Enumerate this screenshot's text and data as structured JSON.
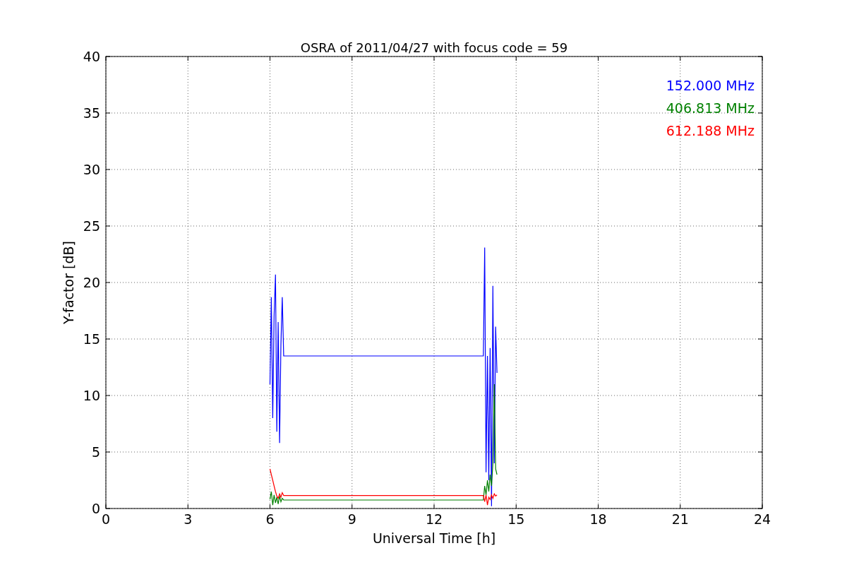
{
  "chart_data": {
    "type": "line",
    "title": "OSRA of 2011/04/27 with focus code = 59",
    "xlabel": "Universal Time [h]",
    "ylabel": "Y-factor [dB]",
    "x": [
      6.0,
      6.05,
      6.1,
      6.15,
      6.2,
      6.25,
      6.3,
      6.35,
      6.4,
      6.45,
      6.5,
      13.8,
      13.85,
      13.9,
      13.95,
      14.0,
      14.05,
      14.1,
      14.15,
      14.2,
      14.25,
      14.3
    ],
    "series": [
      {
        "name": "152.000 MHz",
        "color": "#0000ff",
        "values": [
          11,
          18.7,
          8,
          17,
          20.7,
          6.8,
          16.5,
          5.8,
          14.5,
          18.7,
          13.5,
          13.5,
          23.1,
          3.2,
          13.5,
          2.5,
          14.2,
          0.2,
          19.7,
          4,
          16.1,
          12
        ]
      },
      {
        "name": "406.813 MHz",
        "color": "#008000",
        "values": [
          0.8,
          1.5,
          0.3,
          1.2,
          0.5,
          1.0,
          0.4,
          1.1,
          0.6,
          0.9,
          0.75,
          0.75,
          2,
          1.2,
          2.5,
          1.5,
          3,
          2,
          4,
          11,
          3.5,
          3
        ]
      },
      {
        "name": "612.188 MHz",
        "color": "#ff0000",
        "values": [
          3.5,
          3,
          2.5,
          2,
          1.5,
          1.1,
          0.9,
          1.3,
          1.0,
          1.4,
          1.15,
          1.15,
          0.6,
          1.2,
          0.3,
          1.0,
          0.8,
          1.2,
          0.9,
          1.3,
          1.1,
          1.2
        ]
      }
    ],
    "grid": true,
    "xlim": [
      0,
      24
    ],
    "ylim": [
      0,
      40
    ],
    "xticks": [
      0,
      3,
      6,
      9,
      12,
      15,
      18,
      21,
      24
    ],
    "yticks": [
      0,
      5,
      10,
      15,
      20,
      25,
      30,
      35,
      40
    ]
  }
}
